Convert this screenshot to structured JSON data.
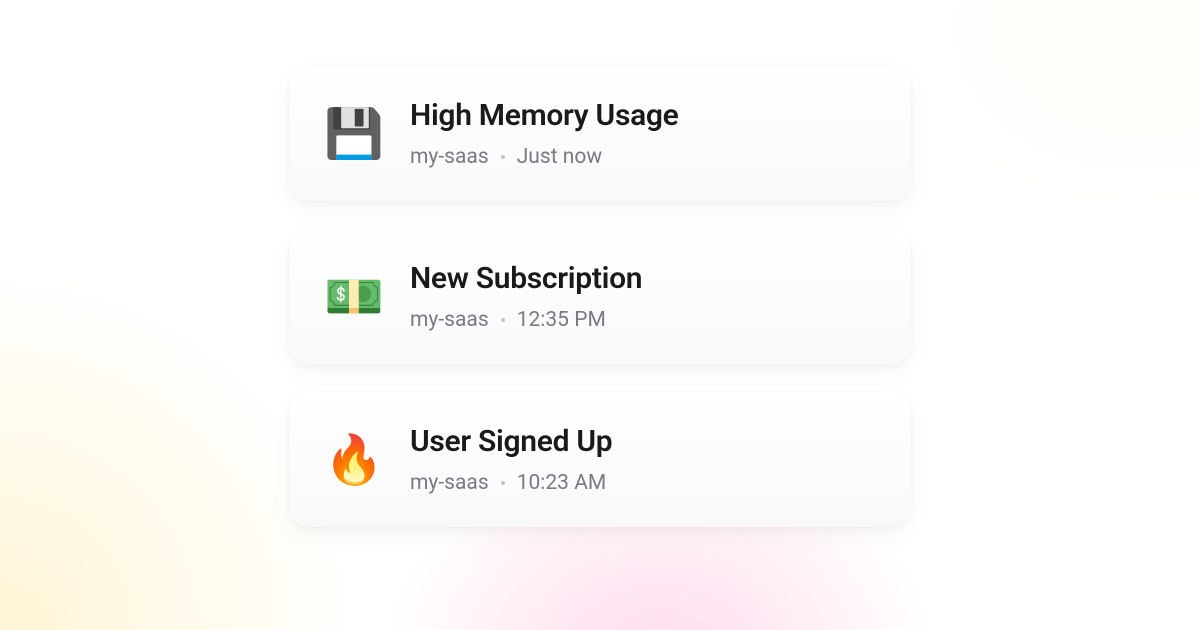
{
  "notifications": [
    {
      "icon": "💾",
      "icon_name": "floppy-disk-icon",
      "title": "High Memory Usage",
      "project": "my-saas",
      "time": "Just now"
    },
    {
      "icon": "💵",
      "icon_name": "money-icon",
      "title": "New Subscription",
      "project": "my-saas",
      "time": "12:35 PM"
    },
    {
      "icon": "🔥",
      "icon_name": "fire-icon",
      "title": "User Signed Up",
      "project": "my-saas",
      "time": "10:23 AM"
    }
  ]
}
